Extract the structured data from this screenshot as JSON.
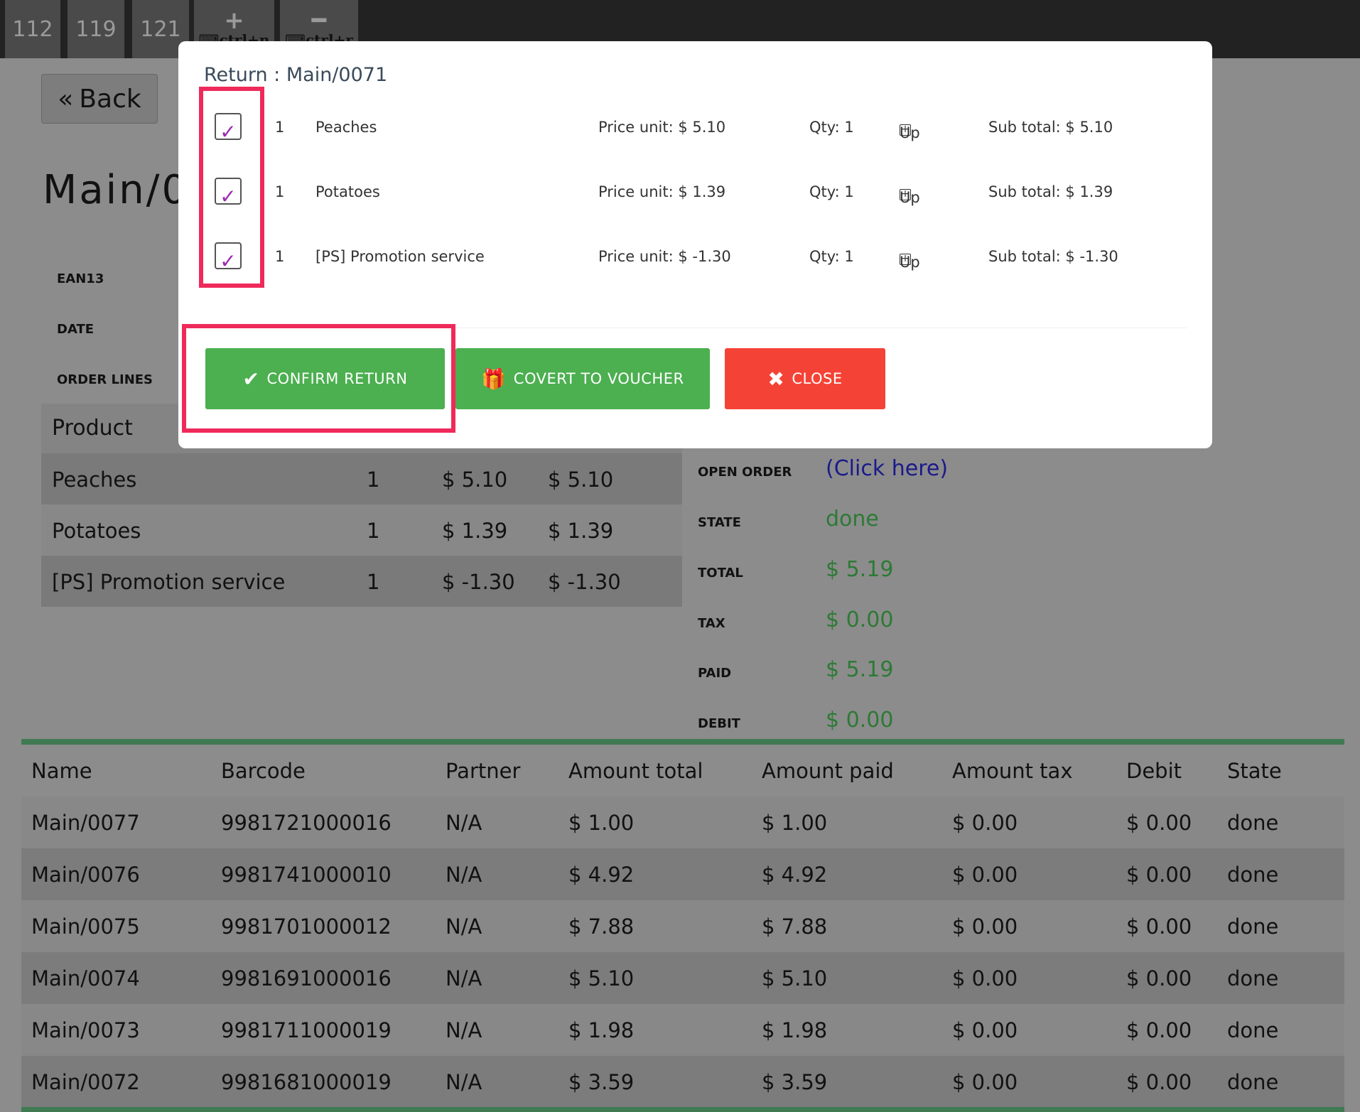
{
  "top_tabs": [
    {
      "label": "112"
    },
    {
      "label": "119"
    },
    {
      "label": "121"
    },
    {
      "icon": "plus-icon",
      "glyph": "+",
      "shortcut": "⌨ctrl+n"
    },
    {
      "icon": "minus-icon",
      "glyph": "━",
      "shortcut": "⌨ctrl+r"
    }
  ],
  "page": {
    "back_label": "Back",
    "order_title": "Main/0",
    "labels": {
      "ean13": "EAN13",
      "date": "DATE",
      "order_lines": "ORDER LINES"
    },
    "lines_header": "Product",
    "lines": [
      {
        "product": "Peaches",
        "qty": "1",
        "price": "$ 5.10",
        "subtotal": "$ 5.10"
      },
      {
        "product": "Potatoes",
        "qty": "1",
        "price": "$ 1.39",
        "subtotal": "$ 1.39"
      },
      {
        "product": "[PS] Promotion service",
        "qty": "1",
        "price": "$ -1.30",
        "subtotal": "$ -1.30"
      }
    ],
    "info": [
      {
        "label": "OPEN ORDER",
        "value": "(Click here)"
      },
      {
        "label": "STATE",
        "value": "done"
      },
      {
        "label": "TOTAL",
        "value": "$ 5.19"
      },
      {
        "label": "TAX",
        "value": "$ 0.00"
      },
      {
        "label": "PAID",
        "value": "$ 5.19"
      },
      {
        "label": "DEBIT",
        "value": "$ 0.00"
      }
    ],
    "orders_columns": [
      "Name",
      "Barcode",
      "Partner",
      "Amount total",
      "Amount paid",
      "Amount tax",
      "Debit",
      "State"
    ],
    "orders": [
      [
        "Main/0077",
        "9981721000016",
        "N/A",
        "$ 1.00",
        "$ 1.00",
        "$ 0.00",
        "$ 0.00",
        "done"
      ],
      [
        "Main/0076",
        "9981741000010",
        "N/A",
        "$ 4.92",
        "$ 4.92",
        "$ 0.00",
        "$ 0.00",
        "done"
      ],
      [
        "Main/0075",
        "9981701000012",
        "N/A",
        "$ 7.88",
        "$ 7.88",
        "$ 0.00",
        "$ 0.00",
        "done"
      ],
      [
        "Main/0074",
        "9981691000016",
        "N/A",
        "$ 5.10",
        "$ 5.10",
        "$ 0.00",
        "$ 0.00",
        "done"
      ],
      [
        "Main/0073",
        "9981711000019",
        "N/A",
        "$ 1.98",
        "$ 1.98",
        "$ 0.00",
        "$ 0.00",
        "done"
      ],
      [
        "Main/0072",
        "9981681000019",
        "N/A",
        "$ 3.59",
        "$ 3.59",
        "$ 0.00",
        "$ 0.00",
        "done"
      ]
    ]
  },
  "modal": {
    "title": "Return : Main/0071",
    "lines": [
      {
        "checked": true,
        "qty": "1",
        "product": "Peaches",
        "price": "Price unit: $ 5.10",
        "qty_label": "Qty: 1",
        "up": "Up",
        "subtotal": "Sub total: $ 5.10"
      },
      {
        "checked": true,
        "qty": "1",
        "product": "Potatoes",
        "price": "Price unit: $ 1.39",
        "qty_label": "Qty: 1",
        "up": "Up",
        "subtotal": "Sub total: $ 1.39"
      },
      {
        "checked": true,
        "qty": "1",
        "product": "[PS] Promotion service",
        "price": "Price unit: $ -1.30",
        "qty_label": "Qty: 1",
        "up": "Up",
        "subtotal": "Sub total: $ -1.30"
      }
    ],
    "buttons": {
      "confirm": "CONFIRM RETURN",
      "voucher": "COVERT TO VOUCHER",
      "close": "CLOSE"
    }
  },
  "colors": {
    "accent_green": "#4caf50",
    "danger_red": "#f44336",
    "highlight": "#ef2a5a",
    "checkmark": "#9b27b0",
    "value_green": "#2d7a35",
    "link_blue": "#1a1a8c"
  }
}
